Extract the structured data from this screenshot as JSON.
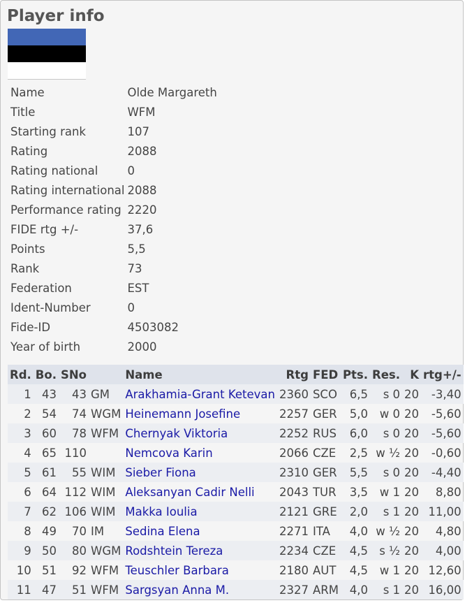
{
  "page_title": "Player info",
  "flag_colors": [
    "#4267b6",
    "#000000",
    "#ffffff"
  ],
  "info": [
    {
      "label": "Name",
      "value": "Olde Margareth"
    },
    {
      "label": "Title",
      "value": "WFM"
    },
    {
      "label": "Starting rank",
      "value": "107"
    },
    {
      "label": "Rating",
      "value": "2088"
    },
    {
      "label": "Rating national",
      "value": "0"
    },
    {
      "label": "Rating international",
      "value": "2088"
    },
    {
      "label": "Performance rating",
      "value": "2220"
    },
    {
      "label": "FIDE rtg +/-",
      "value": "37,6"
    },
    {
      "label": "Points",
      "value": "5,5"
    },
    {
      "label": "Rank",
      "value": "73"
    },
    {
      "label": "Federation",
      "value": "EST"
    },
    {
      "label": "Ident-Number",
      "value": "0"
    },
    {
      "label": "Fide-ID",
      "value": "4503082"
    },
    {
      "label": "Year of birth",
      "value": "2000"
    }
  ],
  "results": {
    "headers": [
      "Rd.",
      "Bo.",
      "SNo",
      "",
      "Name",
      "Rtg",
      "FED",
      "Pts.",
      "Res.",
      "K",
      "rtg+/-"
    ],
    "rows": [
      [
        "1",
        "43",
        "43",
        "GM",
        "Arakhamia-Grant Ketevan",
        "2360",
        "SCO",
        "6,5",
        "s 0",
        "20",
        "-3,40"
      ],
      [
        "2",
        "54",
        "74",
        "WGM",
        "Heinemann Josefine",
        "2257",
        "GER",
        "5,0",
        "w 0",
        "20",
        "-5,60"
      ],
      [
        "3",
        "60",
        "78",
        "WFM",
        "Chernyak Viktoria",
        "2252",
        "RUS",
        "6,0",
        "s 0",
        "20",
        "-5,60"
      ],
      [
        "4",
        "65",
        "110",
        "",
        "Nemcova Karin",
        "2066",
        "CZE",
        "2,5",
        "w ½",
        "20",
        "-0,60"
      ],
      [
        "5",
        "61",
        "55",
        "WIM",
        "Sieber Fiona",
        "2310",
        "GER",
        "5,5",
        "s 0",
        "20",
        "-4,40"
      ],
      [
        "6",
        "64",
        "112",
        "WIM",
        "Aleksanyan Cadir Nelli",
        "2043",
        "TUR",
        "3,5",
        "w 1",
        "20",
        "8,80"
      ],
      [
        "7",
        "62",
        "106",
        "WIM",
        "Makka Ioulia",
        "2121",
        "GRE",
        "2,0",
        "s 1",
        "20",
        "11,00"
      ],
      [
        "8",
        "49",
        "70",
        "IM",
        "Sedina Elena",
        "2271",
        "ITA",
        "4,0",
        "w ½",
        "20",
        "4,80"
      ],
      [
        "9",
        "50",
        "80",
        "WGM",
        "Rodshtein Tereza",
        "2234",
        "CZE",
        "4,5",
        "s ½",
        "20",
        "4,00"
      ],
      [
        "10",
        "51",
        "92",
        "WFM",
        "Teuschler Barbara",
        "2180",
        "AUT",
        "4,5",
        "w 1",
        "20",
        "12,60"
      ],
      [
        "11",
        "47",
        "51",
        "WFM",
        "Sargsyan Anna M.",
        "2327",
        "ARM",
        "4,0",
        "s 1",
        "20",
        "16,00"
      ]
    ]
  }
}
